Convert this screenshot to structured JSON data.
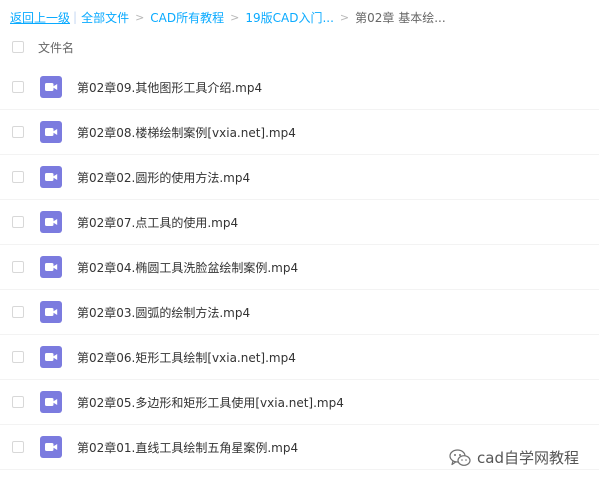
{
  "breadcrumb": {
    "back": "返回上一级",
    "items": [
      "全部文件",
      "CAD所有教程",
      "19版CAD入门...",
      "第02章 基本绘..."
    ]
  },
  "list_header": {
    "name_label": "文件名"
  },
  "files": [
    {
      "name": "第02章09.其他图形工具介绍.mp4",
      "icon": "video-file-icon"
    },
    {
      "name": "第02章08.楼梯绘制案例[vxia.net].mp4",
      "icon": "video-file-icon"
    },
    {
      "name": "第02章02.圆形的使用方法.mp4",
      "icon": "video-file-icon"
    },
    {
      "name": "第02章07.点工具的使用.mp4",
      "icon": "video-file-icon"
    },
    {
      "name": "第02章04.椭圆工具洗脸盆绘制案例.mp4",
      "icon": "video-file-icon"
    },
    {
      "name": "第02章03.圆弧的绘制方法.mp4",
      "icon": "video-file-icon"
    },
    {
      "name": "第02章06.矩形工具绘制[vxia.net].mp4",
      "icon": "video-file-icon"
    },
    {
      "name": "第02章05.多边形和矩形工具使用[vxia.net].mp4",
      "icon": "video-file-icon"
    },
    {
      "name": "第02章01.直线工具绘制五角星案例.mp4",
      "icon": "video-file-icon"
    }
  ],
  "watermark": {
    "text": "cad自学网教程",
    "icon": "wechat-icon"
  },
  "colors": {
    "link": "#09aaff",
    "video_icon": "#7b7bdf"
  }
}
